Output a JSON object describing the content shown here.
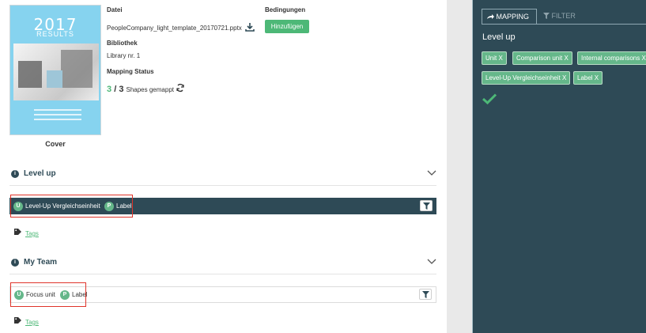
{
  "cover": {
    "year": "2017",
    "results": "RESULTS",
    "label": "Cover"
  },
  "file": {
    "datei_label": "Datei",
    "filename": "PeopleCompany_light_template_20170721.pptx"
  },
  "conditions": {
    "label": "Bedingungen",
    "add_button": "Hinzufügen"
  },
  "library": {
    "label": "Bibliothek",
    "value": "Library nr. 1"
  },
  "mapping_status": {
    "label": "Mapping Status",
    "mapped": "3",
    "slash": "/",
    "total": "3",
    "suffix": "Shapes gemappt"
  },
  "sections": [
    {
      "title": "Level up",
      "chips": [
        {
          "badge": "U",
          "text": "Level-Up Vergleichseinheit"
        },
        {
          "badge": "P",
          "text": "Label"
        }
      ],
      "tags": "Tags"
    },
    {
      "title": "My Team",
      "chips": [
        {
          "badge": "U",
          "text": "Focus unit"
        },
        {
          "badge": "P",
          "text": "Label"
        }
      ],
      "tags": "Tags"
    }
  ],
  "right_panel": {
    "tabs": [
      {
        "label": "MAPPING"
      },
      {
        "label": "FILTER"
      }
    ],
    "title": "Level up",
    "chips": [
      {
        "text": "Unit  X"
      },
      {
        "text": "Comparison unit  X"
      },
      {
        "text": "Internal comparisons  X"
      },
      {
        "text": "Level-Up Vergleichseinheit  X"
      },
      {
        "text": "Label  X"
      }
    ]
  },
  "colors": {
    "accent": "#4db877",
    "panel": "#2e4a56",
    "cover": "#86d3ef",
    "highlight": "#e0342a"
  }
}
